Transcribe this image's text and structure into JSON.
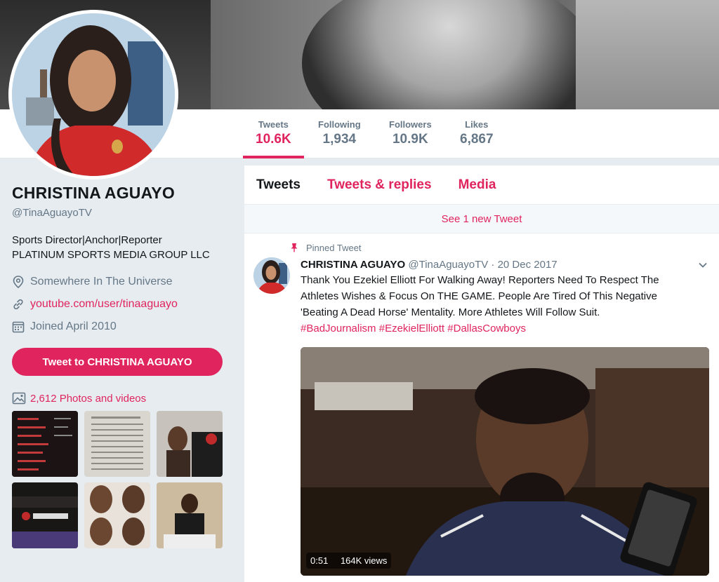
{
  "stats": [
    {
      "label": "Tweets",
      "value": "10.6K"
    },
    {
      "label": "Following",
      "value": "1,934"
    },
    {
      "label": "Followers",
      "value": "10.9K"
    },
    {
      "label": "Likes",
      "value": "6,867"
    }
  ],
  "profile": {
    "name": "CHRISTINA AGUAYO",
    "handle": "@TinaAguayoTV",
    "bio_line1": "Sports Director|Anchor|Reporter",
    "bio_line2": "PLATINUM SPORTS MEDIA GROUP LLC",
    "location": "Somewhere In The Universe",
    "website": "youtube.com/user/tinaaguayo",
    "joined": "Joined April 2010",
    "tweet_to_label": "Tweet to CHRISTINA AGUAYO",
    "photos_label": "2,612 Photos and videos"
  },
  "tabs": [
    "Tweets",
    "Tweets & replies",
    "Media"
  ],
  "new_tweet_banner": "See 1 new Tweet",
  "tweet": {
    "pinned_label": "Pinned Tweet",
    "author": "CHRISTINA AGUAYO",
    "handle_date": "@TinaAguayoTV · 20 Dec 2017",
    "text_line1": "Thank You Ezekiel Elliott For Walking Away! Reporters Need To Respect The",
    "text_line2": "Athletes Wishes & Focus On THE GAME. People Are Tired Of This Negative",
    "text_line3": "'Beating A Dead Horse' Mentality.  More Athletes Will Follow Suit.",
    "hashtags": "#BadJournalism #EzekielElliott #DallasCowboys",
    "video_duration": "0:51",
    "video_views": "164K views"
  },
  "colors": {
    "accent": "#e0245e",
    "secondary_text": "#657786",
    "background": "#e6ecf0"
  },
  "icons": {
    "location": "location-pin-icon",
    "link": "link-icon",
    "calendar": "calendar-icon",
    "photos": "image-icon",
    "pin": "pin-icon",
    "caret": "chevron-down-icon"
  }
}
